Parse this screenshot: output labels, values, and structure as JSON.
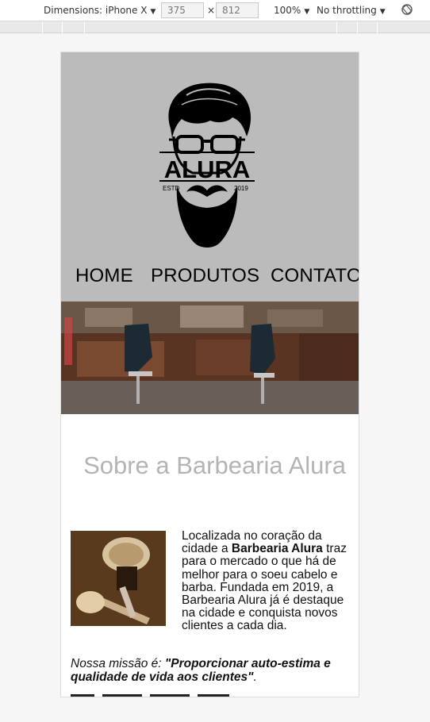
{
  "devtools": {
    "dimensions_label": "Dimensions: iPhone X",
    "width_value": "375",
    "times_sign": "×",
    "height_value": "812",
    "zoom_label": "100%",
    "throttle_label": "No throttling",
    "rotate_icon": "rotate-icon"
  },
  "site": {
    "logo": {
      "brand": "ALURA",
      "estd": "ESTD",
      "year": "2019"
    },
    "nav": [
      "HOME",
      "PRODUTOS",
      "CONTATO"
    ],
    "banner_alt": "barbershop-interior",
    "section_title": "Sobre a Barbearia Alura",
    "about": {
      "part1": "Localizada no coração da cidade a ",
      "bold": "Barbearia Alura",
      "part2": " traz para o mercado o que há de melhor para o soeu cabelo e barba. Fundada em 2019, a Barbearia Alura já é destaque na cidade e conquista novos clientes a cada dia."
    },
    "mission": {
      "prefix": "Nossa missão é: ",
      "quote": "\"Proporcionar auto-estima e qualidade de vida aos clientes\"",
      "suffix": "."
    }
  },
  "colors": {
    "header_bg": "#bbbbbb",
    "title": "#b4b4b4",
    "text": "#111111"
  }
}
